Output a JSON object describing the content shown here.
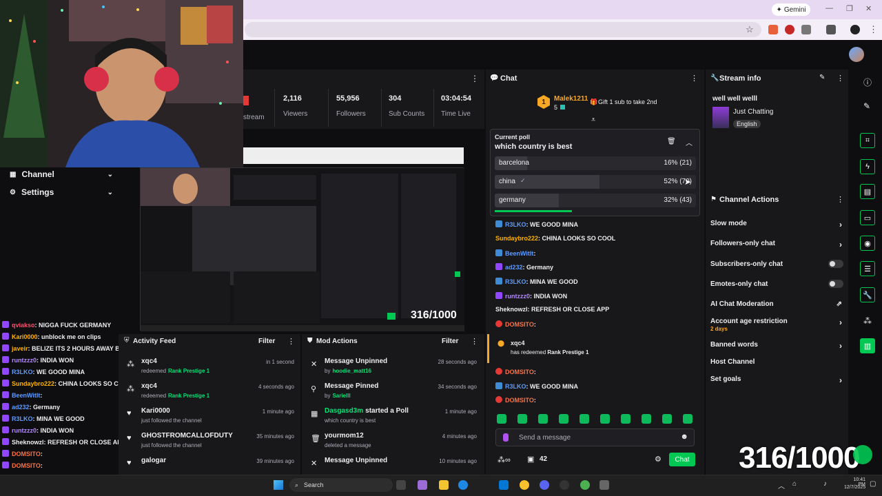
{
  "browser": {
    "gemini_label": "Gemini"
  },
  "stats": {
    "partial_label": "stream",
    "items": [
      {
        "value": "2,116",
        "label": "Viewers"
      },
      {
        "value": "55,956",
        "label": "Followers"
      },
      {
        "value": "304",
        "label": "Sub Counts"
      },
      {
        "value": "03:04:54",
        "label": "Time Live"
      }
    ]
  },
  "nav": {
    "channel": "Channel",
    "settings": "Settings"
  },
  "left_chat": [
    {
      "user": "qviakso",
      "text": ": NIGGA FUCK GERMANY",
      "color": "#ff4d6d"
    },
    {
      "user": "Kari0000",
      "text": ": unblock me on clips",
      "color": "#ffb300"
    },
    {
      "user": "javeir",
      "text": ": BELIZE ITS 2 HOURS AWAY BY PLANE",
      "color": "#ffb300"
    },
    {
      "user": "runtzzz0",
      "text": ": INDIA WON",
      "color": "#b388ff"
    },
    {
      "user": "R3LKO",
      "text": ": WE GOOD MINA",
      "color": "#5b9bff"
    },
    {
      "user": "Sundaybro222",
      "text": ": CHINA LOOKS SO COOL",
      "color": "#ffb300"
    },
    {
      "user": "BeenWitIt",
      "text": ":",
      "color": "#5b9bff"
    },
    {
      "user": "ad232",
      "text": ": Germany",
      "color": "#5b9bff"
    },
    {
      "user": "R3LKO",
      "text": ": MINA WE GOOD",
      "color": "#5b9bff"
    },
    {
      "user": "runtzzz0",
      "text": ": INDIA WON",
      "color": "#b388ff"
    },
    {
      "user": "Sheknowzl",
      "text": ": REFRESH OR CLOSE APP",
      "color": "#efeff1"
    },
    {
      "user": "DOMSITO",
      "text": ":",
      "color": "#ff7043"
    },
    {
      "user": "DOMSITO",
      "text": ":",
      "color": "#ff7043"
    }
  ],
  "activity": {
    "title": "Activity Feed",
    "filter": "Filter",
    "items": [
      {
        "name": "xqc4",
        "pre": "redeemed",
        "hl": "Rank Prestige 1",
        "time": "in 1 second",
        "icon": "reward-icon"
      },
      {
        "name": "xqc4",
        "pre": "redeemed",
        "hl": "Rank Prestige 1",
        "time": "4 seconds ago",
        "icon": "reward-icon"
      },
      {
        "name": "Kari0000",
        "pre": "just followed the channel",
        "hl": "",
        "time": "1 minute ago",
        "icon": "heart-icon"
      },
      {
        "name": "GHOSTFROMCALLOFDUTY",
        "pre": "just followed the channel",
        "hl": "",
        "time": "35 minutes ago",
        "icon": "heart-icon"
      },
      {
        "name": "galogar",
        "pre": "",
        "hl": "",
        "time": "39 minutes ago",
        "icon": "heart-icon"
      }
    ]
  },
  "modactions": {
    "title": "Mod Actions",
    "filter": "Filter",
    "items": [
      {
        "title": "Message Unpinned",
        "sub_pre": "by",
        "sub_hl": "hoodie_matt16",
        "time": "28 seconds ago"
      },
      {
        "title": "Message Pinned",
        "sub_pre": "by",
        "sub_hl": "Sarielll",
        "time": "34 seconds ago"
      },
      {
        "title_hl": "Dasgasd3m",
        "title": "started a Poll",
        "sub_pre": "which country is best",
        "sub_hl": "",
        "time": "1 minute ago"
      },
      {
        "title": "yourmom12",
        "sub_pre": "deleted a message",
        "sub_hl": "",
        "time": "4 minutes ago"
      },
      {
        "title": "Message Unpinned",
        "sub_pre": "",
        "sub_hl": "",
        "time": "10 minutes ago"
      }
    ]
  },
  "chat": {
    "title": "Chat",
    "top_user": "Malek1211",
    "top_rank": "1",
    "top_count": "5",
    "gift_text": "Gift 1 sub to take 2nd",
    "poll": {
      "kicker": "Current poll",
      "question": "which country is best",
      "options": [
        {
          "label": "barcelona",
          "value": "16% (21)",
          "pct": 16
        },
        {
          "label": "china",
          "value": "52% (70)",
          "pct": 52
        },
        {
          "label": "germany",
          "value": "32% (43)",
          "pct": 32
        }
      ]
    },
    "messages": [
      {
        "user": "R3LKO",
        "text": ": WE GOOD MINA",
        "color": "#5b9bff",
        "badge": "b"
      },
      {
        "user": "Sundaybro222",
        "text": ": CHINA LOOKS SO COOL",
        "color": "#ffb300",
        "badge": ""
      },
      {
        "user": "BeenWitIt",
        "text": ":",
        "color": "#5b9bff",
        "badge": "b"
      },
      {
        "user": "ad232",
        "text": ": Germany",
        "color": "#5b9bff",
        "badge": "p"
      },
      {
        "user": "R3LKO",
        "text": ": MINA WE GOOD",
        "color": "#5b9bff",
        "badge": "b"
      },
      {
        "user": "runtzzz0",
        "text": ": INDIA WON",
        "color": "#b388ff",
        "badge": "p"
      },
      {
        "user": "Sheknowzl",
        "text": ": REFRESH OR CLOSE APP",
        "color": "#efeff1",
        "badge": ""
      },
      {
        "user": "DOMSITO",
        "text": ":",
        "color": "#ff7043",
        "badge": "g"
      }
    ],
    "redeem_user": "xqc4",
    "redeem_text": "has redeemed",
    "redeem_hl": "Rank Prestige 1",
    "after": [
      {
        "user": "DOMSITO",
        "text": ":",
        "color": "#ff7043",
        "badge": "g"
      },
      {
        "user": "R3LKO",
        "text": ": WE GOOD MINA",
        "color": "#5b9bff",
        "badge": "b"
      },
      {
        "user": "DOMSITO",
        "text": ":",
        "color": "#ff7043",
        "badge": "g"
      }
    ],
    "input_placeholder": "Send a message",
    "points": "42",
    "chat_button": "Chat"
  },
  "streaminfo": {
    "title": "Stream info",
    "stream_title": "well well welll",
    "category": "Just Chatting",
    "language": "English"
  },
  "channelactions": {
    "title": "Channel Actions",
    "items": [
      {
        "label": "Slow mode",
        "kind": "chevron"
      },
      {
        "label": "Followers-only chat",
        "kind": "chevron"
      },
      {
        "label": "Subscribers-only chat",
        "kind": "toggle"
      },
      {
        "label": "Emotes-only chat",
        "kind": "toggle"
      },
      {
        "label": "AI Chat Moderation",
        "kind": "external"
      },
      {
        "label": "Account age restriction",
        "kind": "chevron",
        "sub": "2 days"
      },
      {
        "label": "Banned words",
        "kind": "chevron"
      },
      {
        "label": "Host Channel",
        "kind": "none"
      },
      {
        "label": "Set goals",
        "kind": "chevron"
      }
    ]
  },
  "overlay": {
    "counter": "316/1000",
    "counter_small": "316/1000"
  },
  "taskbar": {
    "search": "Search",
    "time": "10:41 PM",
    "date": "12/7/2025"
  }
}
